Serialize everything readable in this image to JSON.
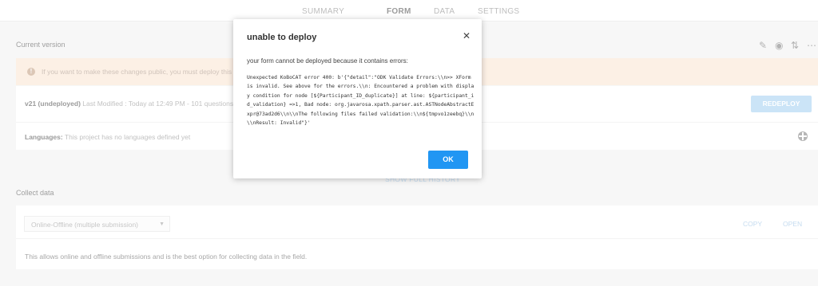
{
  "nav": {
    "tabs": [
      {
        "label": "SUMMARY"
      },
      {
        "label": "FORM"
      },
      {
        "label": "DATA"
      },
      {
        "label": "SETTINGS"
      }
    ]
  },
  "current_version": {
    "label": "Current version",
    "banner": "If you want to make these changes public, you must deploy this form.",
    "version": "v21 (undeployed)",
    "last_modified": "Last Modified : Today at 12:49 PM - 101 questions",
    "redeploy": "REDEPLOY",
    "languages_label": "Languages:",
    "languages_text": "This project has no languages defined yet",
    "show_history": "SHOW FULL HISTORY"
  },
  "collect": {
    "label": "Collect data",
    "select_value": "Online-Offline (multiple submission)",
    "copy": "COPY",
    "open": "OPEN",
    "description": "This allows online and offline submissions and is the best option for collecting data in the field."
  },
  "icons": [
    "pencil-icon",
    "eye-icon",
    "sync-icon",
    "more-icon",
    "info-icon",
    "globe-icon",
    "close-icon"
  ],
  "modal": {
    "title": "unable to deploy",
    "message": "your form cannot be deployed because it contains errors:",
    "error": "Unexpected KoBoCAT error 400: b'{\"detail\":\"ODK Validate Errors:\\\\n>> XForm is invalid. See above for the errors.\\\\n: Encountered a problem with display condition for node [${Participant_ID_duplicate}] at line: ${participant_id_validation} =>1, Bad node: org.javarosa.xpath.parser.ast.ASTNodeAbstractExpr@73ad2d6\\\\n\\\\nThe following files failed validation:\\\\n${tmpvo1zeebq}\\\\n\\\\nResult: Invalid\"}'",
    "ok": "OK"
  },
  "colors": {
    "accent": "#2196f3",
    "banner_bg": "#fbe8d8",
    "disabled_blue": "#b0d6f3"
  }
}
